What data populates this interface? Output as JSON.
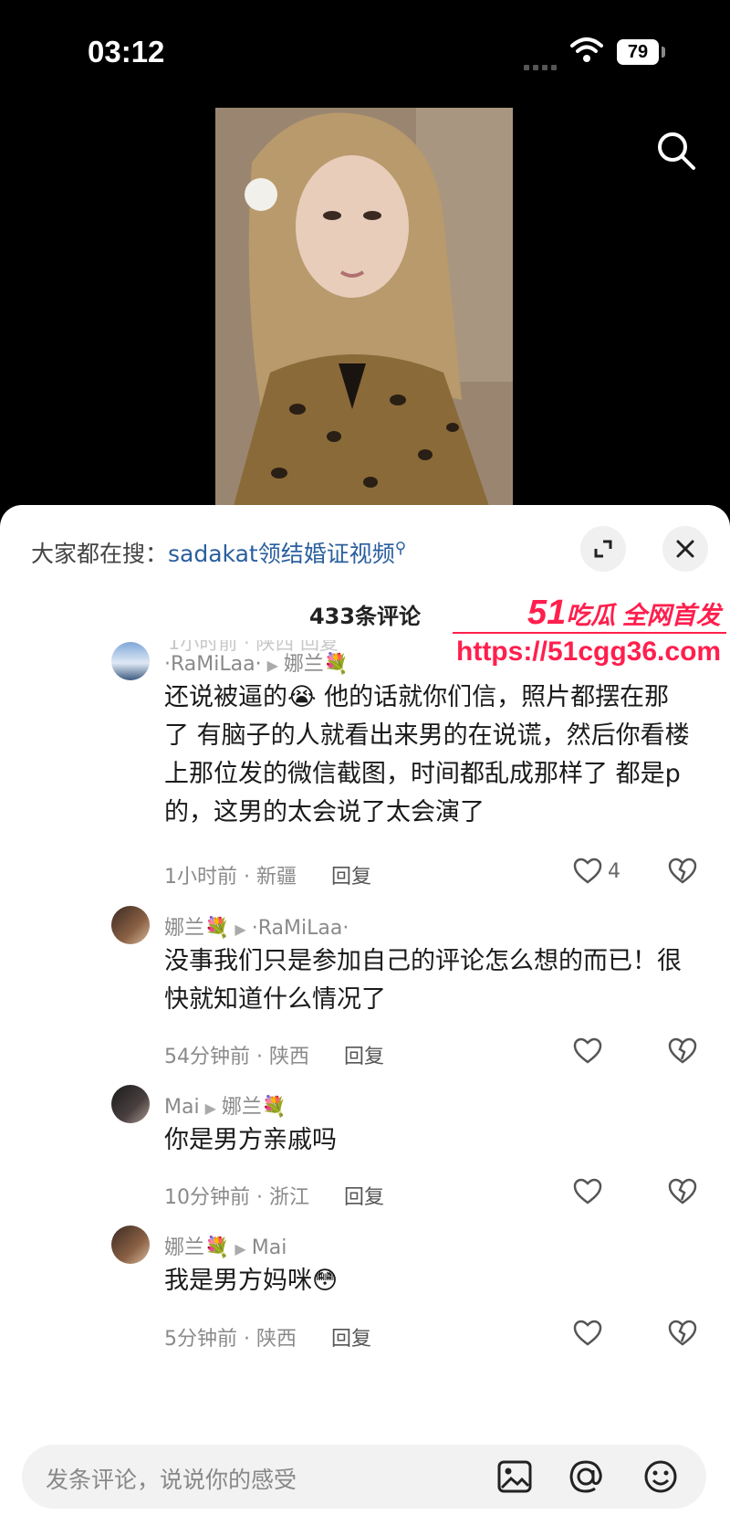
{
  "status": {
    "time": "03:12",
    "battery": "79"
  },
  "panel": {
    "hot_search_label": "大家都在搜：",
    "hot_search_term": "sadakat领结婚证视频",
    "comment_count": "433条评论",
    "faded_meta": "1小时前 · 陕西  回复"
  },
  "comments": [
    {
      "user": "·RaMiLaa·",
      "reply_to": "娜兰",
      "text": "还说被逼的😭 他的话就你们信，照片都摆在那了 有脑子的人就看出来男的在说谎，然后你看楼上那位发的微信截图，时间都乱成那样了 都是p的，这男的太会说了太会演了",
      "time_loc": "1小时前 · 新疆",
      "reply": "回复",
      "likes": "4"
    },
    {
      "user": "娜兰",
      "reply_to": "·RaMiLaa·",
      "text": "没事我们只是参加自己的评论怎么想的而已！很快就知道什么情况了",
      "time_loc": "54分钟前 · 陕西",
      "reply": "回复",
      "likes": ""
    },
    {
      "user": "Mai",
      "reply_to": "娜兰",
      "text": "你是男方亲戚吗",
      "time_loc": "10分钟前 · 浙江",
      "reply": "回复",
      "likes": ""
    },
    {
      "user": "娜兰",
      "reply_to": "Mai",
      "text": "我是男方妈咪😳",
      "time_loc": "5分钟前 · 陕西",
      "reply": "回复",
      "likes": ""
    }
  ],
  "input": {
    "placeholder": "发条评论，说说你的感受"
  },
  "watermark": {
    "logo_num": "51",
    "logo_text": "吃瓜 全网首发",
    "url": "https://51cgg36.com"
  },
  "icons": [
    "search-icon",
    "wifi-icon",
    "expand-icon",
    "close-icon",
    "like-icon",
    "dislike-icon",
    "image-icon",
    "at-icon",
    "emoji-icon"
  ],
  "colors": {
    "link": "#2a5f9e",
    "watermark": "#ff1f4d",
    "sheet": "#ffffff",
    "input_bg": "#f2f2f2"
  }
}
